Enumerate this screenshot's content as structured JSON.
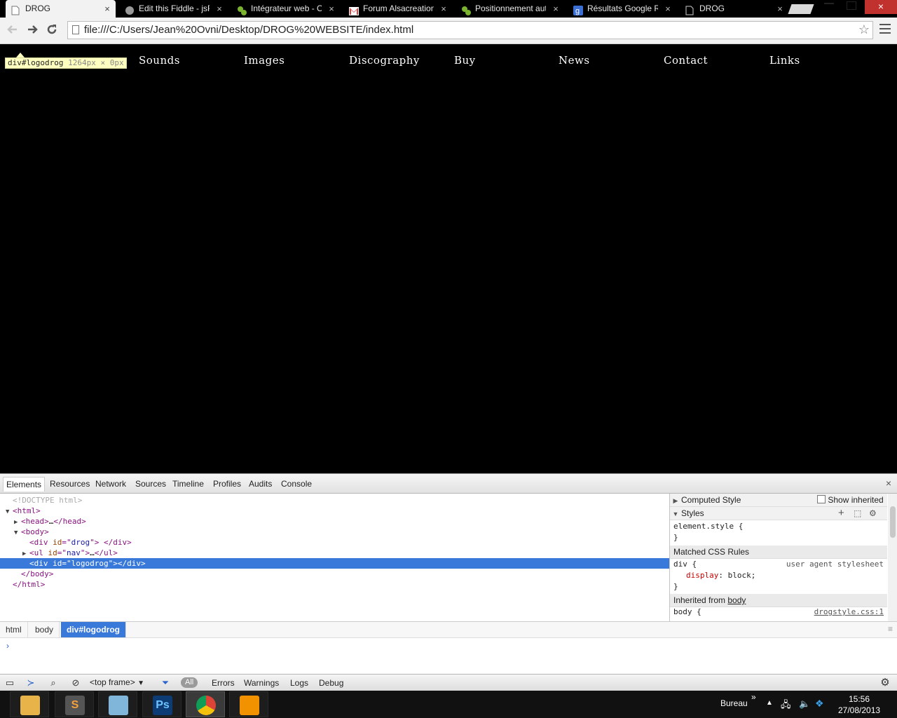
{
  "browser": {
    "tabs": [
      {
        "title": "DROG",
        "icon": "page-icon",
        "active": true
      },
      {
        "title": "Edit this Fiddle - jsFiddle",
        "icon": "jsfiddle-icon",
        "active": false
      },
      {
        "title": "Intégrateur web - Offre",
        "icon": "frog-icon",
        "active": false
      },
      {
        "title": "Forum Alsacreations",
        "icon": "gmail-icon",
        "active": false
      },
      {
        "title": "Positionnement automatique",
        "icon": "frog-icon",
        "active": false
      },
      {
        "title": "Résultats Google Recherche",
        "icon": "google-icon",
        "active": false
      },
      {
        "title": "DROG",
        "icon": "page-icon",
        "active": false
      }
    ],
    "close_glyph": "×",
    "url": "file:///C:/Users/Jean%20Ovni/Desktop/DROG%20WEBSITE/index.html"
  },
  "page": {
    "nav": [
      "Sounds",
      "Images",
      "Discography",
      "Buy",
      "News",
      "Contact",
      "Links"
    ],
    "inspect_tooltip": {
      "selector": "div#logodrog",
      "size": "1264px × 0px"
    }
  },
  "devtools": {
    "tabs": [
      "Elements",
      "Resources",
      "Network",
      "Sources",
      "Timeline",
      "Profiles",
      "Audits",
      "Console"
    ],
    "tree": [
      {
        "text": "<!DOCTYPE html>"
      },
      {
        "open": "<html>"
      },
      {
        "open": "<head>",
        "inner": "…",
        "close": "</head>"
      },
      {
        "open": "<body>"
      },
      {
        "tag": "div",
        "attr": "id",
        "val": "drog",
        "inner": " ",
        "close": "</div>"
      },
      {
        "tag": "ul",
        "attr": "id",
        "val": "nav",
        "inner": "…",
        "close": "</ul>"
      },
      {
        "tag": "div",
        "attr": "id",
        "val": "logodrog",
        "inner": "",
        "close": "</div>"
      },
      {
        "close": "</body>"
      },
      {
        "close": "</html>"
      }
    ],
    "sidebar": {
      "computed_style": "Computed Style",
      "show_inherited": "Show inherited",
      "styles": "Styles",
      "element_style_open": "element.style {",
      "brace_close": "}",
      "matched_rules": "Matched CSS Rules",
      "div_rule_open": "div {",
      "user_agent": "user agent stylesheet",
      "div_prop": "display",
      "div_val": "block;",
      "inherited_from": "Inherited from ",
      "inherited_el": "body",
      "body_rule_open": "body {",
      "body_src": "drogstyle.css:1"
    },
    "breadcrumbs": [
      "html",
      "body",
      "div#logodrog"
    ],
    "prompt": "›",
    "status_bar": {
      "frame": "<top frame>",
      "all": "All",
      "filters": [
        "Errors",
        "Warnings",
        "Logs",
        "Debug"
      ]
    }
  },
  "taskbar": {
    "apps": [
      {
        "name": "file-explorer",
        "glyph": ""
      },
      {
        "name": "sublime-text",
        "glyph": "S"
      },
      {
        "name": "notepad",
        "glyph": ""
      },
      {
        "name": "photoshop",
        "glyph": "Ps"
      },
      {
        "name": "chrome",
        "glyph": ""
      },
      {
        "name": "media-player",
        "glyph": ""
      }
    ],
    "toolbar_label": "Bureau",
    "time": "15:56",
    "date": "27/08/2013"
  }
}
